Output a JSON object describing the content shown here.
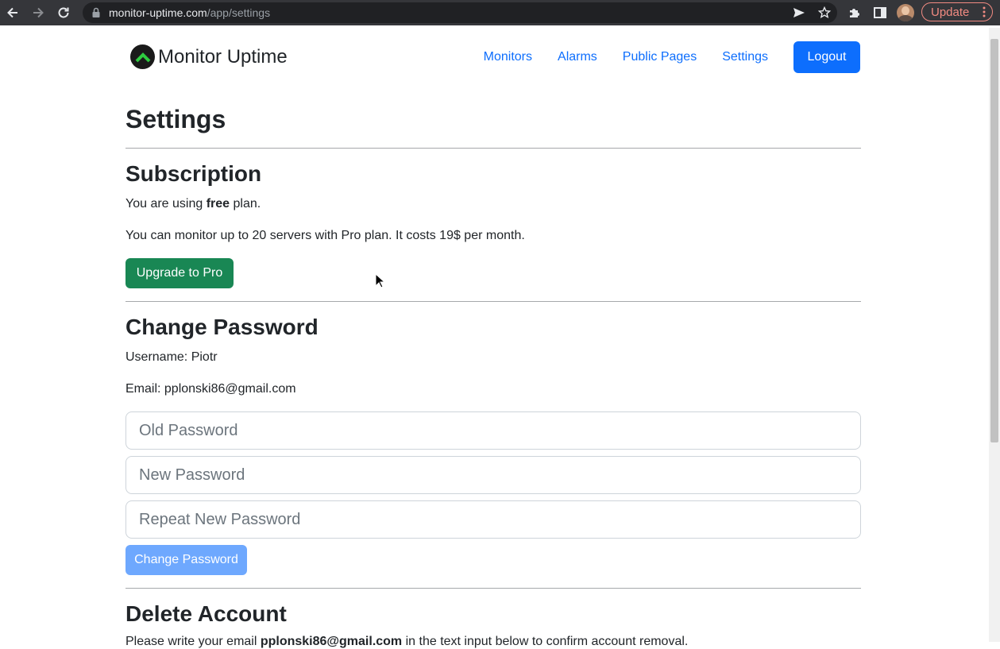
{
  "browser": {
    "url_domain": "monitor-uptime.com",
    "url_path": "/app/settings",
    "update_label": "Update"
  },
  "navbar": {
    "brand": "Monitor Uptime",
    "links": [
      "Monitors",
      "Alarms",
      "Public Pages",
      "Settings"
    ],
    "logout_label": "Logout"
  },
  "settings": {
    "title": "Settings",
    "subscription": {
      "heading": "Subscription",
      "plan_prefix": "You are using ",
      "plan_name": "free",
      "plan_suffix": " plan.",
      "pro_info": "You can monitor up to 20 servers with Pro plan. It costs 19$ per month.",
      "upgrade_label": "Upgrade to Pro"
    },
    "change_password": {
      "heading": "Change Password",
      "username_line": "Username: Piotr",
      "email_line": "Email: pplonski86@gmail.com",
      "old_placeholder": "Old Password",
      "new_placeholder": "New Password",
      "repeat_placeholder": "Repeat New Password",
      "submit_label": "Change Password"
    },
    "delete_account": {
      "heading": "Delete Account",
      "instruction_prefix": "Please write your email ",
      "instruction_email": "pplonski86@gmail.com",
      "instruction_suffix": " in the text input below to confirm account removal."
    }
  },
  "colors": {
    "primary": "#0d6efd",
    "success": "#198754",
    "primary_disabled": "#6ea8fe",
    "chrome_bg": "#35363a"
  }
}
